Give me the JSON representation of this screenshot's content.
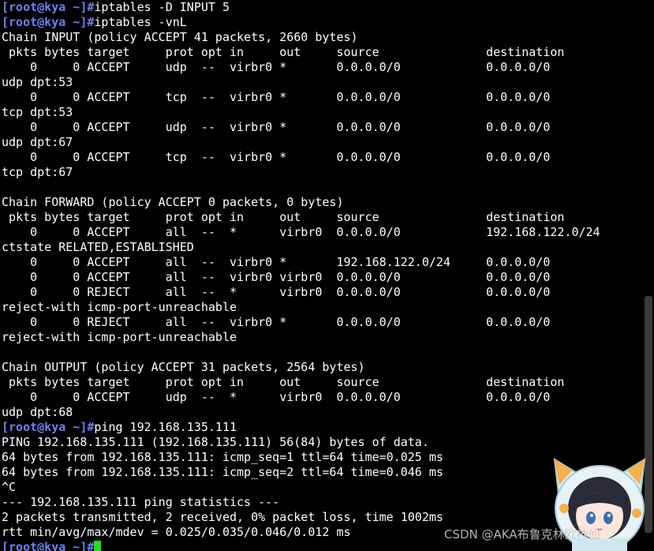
{
  "terminal": {
    "prompt": "[root@kya ~]#",
    "lines": [
      {
        "type": "prompt",
        "cmd": "iptables -D INPUT 5"
      },
      {
        "type": "prompt",
        "cmd": "iptables -vnL"
      },
      {
        "type": "text",
        "text": "Chain INPUT (policy ACCEPT 41 packets, 2660 bytes)"
      },
      {
        "type": "text",
        "text": " pkts bytes target     prot opt in     out     source               destination"
      },
      {
        "type": "text",
        "text": "    0     0 ACCEPT     udp  --  virbr0 *       0.0.0.0/0            0.0.0.0/0"
      },
      {
        "type": "text",
        "text": "udp dpt:53"
      },
      {
        "type": "text",
        "text": "    0     0 ACCEPT     tcp  --  virbr0 *       0.0.0.0/0            0.0.0.0/0"
      },
      {
        "type": "text",
        "text": "tcp dpt:53"
      },
      {
        "type": "text",
        "text": "    0     0 ACCEPT     udp  --  virbr0 *       0.0.0.0/0            0.0.0.0/0"
      },
      {
        "type": "text",
        "text": "udp dpt:67"
      },
      {
        "type": "text",
        "text": "    0     0 ACCEPT     tcp  --  virbr0 *       0.0.0.0/0            0.0.0.0/0"
      },
      {
        "type": "text",
        "text": "tcp dpt:67"
      },
      {
        "type": "text",
        "text": ""
      },
      {
        "type": "text",
        "text": "Chain FORWARD (policy ACCEPT 0 packets, 0 bytes)"
      },
      {
        "type": "text",
        "text": " pkts bytes target     prot opt in     out     source               destination"
      },
      {
        "type": "text",
        "text": "    0     0 ACCEPT     all  --  *      virbr0  0.0.0.0/0            192.168.122.0/24"
      },
      {
        "type": "text",
        "text": "ctstate RELATED,ESTABLISHED"
      },
      {
        "type": "text",
        "text": "    0     0 ACCEPT     all  --  virbr0 *       192.168.122.0/24     0.0.0.0/0"
      },
      {
        "type": "text",
        "text": "    0     0 ACCEPT     all  --  virbr0 virbr0  0.0.0.0/0            0.0.0.0/0"
      },
      {
        "type": "text",
        "text": "    0     0 REJECT     all  --  *      virbr0  0.0.0.0/0            0.0.0.0/0"
      },
      {
        "type": "text",
        "text": "reject-with icmp-port-unreachable"
      },
      {
        "type": "text",
        "text": "    0     0 REJECT     all  --  virbr0 *       0.0.0.0/0            0.0.0.0/0"
      },
      {
        "type": "text",
        "text": "reject-with icmp-port-unreachable"
      },
      {
        "type": "text",
        "text": ""
      },
      {
        "type": "text",
        "text": "Chain OUTPUT (policy ACCEPT 31 packets, 2564 bytes)"
      },
      {
        "type": "text",
        "text": " pkts bytes target     prot opt in     out     source               destination"
      },
      {
        "type": "text",
        "text": "    0     0 ACCEPT     udp  --  *      virbr0  0.0.0.0/0            0.0.0.0/0"
      },
      {
        "type": "text",
        "text": "udp dpt:68"
      },
      {
        "type": "prompt",
        "cmd": "ping 192.168.135.111"
      },
      {
        "type": "text",
        "text": "PING 192.168.135.111 (192.168.135.111) 56(84) bytes of data."
      },
      {
        "type": "text",
        "text": "64 bytes from 192.168.135.111: icmp_seq=1 ttl=64 time=0.025 ms"
      },
      {
        "type": "text",
        "text": "64 bytes from 192.168.135.111: icmp_seq=2 ttl=64 time=0.046 ms"
      },
      {
        "type": "text",
        "text": "^C"
      },
      {
        "type": "text",
        "text": "--- 192.168.135.111 ping statistics ---"
      },
      {
        "type": "text",
        "text": "2 packets transmitted, 2 received, 0% packet loss, time 1002ms"
      },
      {
        "type": "text",
        "text": "rtt min/avg/max/mdev = 0.025/0.035/0.046/0.012 ms"
      },
      {
        "type": "prompt",
        "cmd": "",
        "cursor": true
      }
    ]
  },
  "watermark": "CSDN @AKA布鲁克林欧神仙",
  "colors": {
    "background": "#000000",
    "text": "#ffffff",
    "prompt": "#6a82f2",
    "cursor": "#1ee01e"
  }
}
